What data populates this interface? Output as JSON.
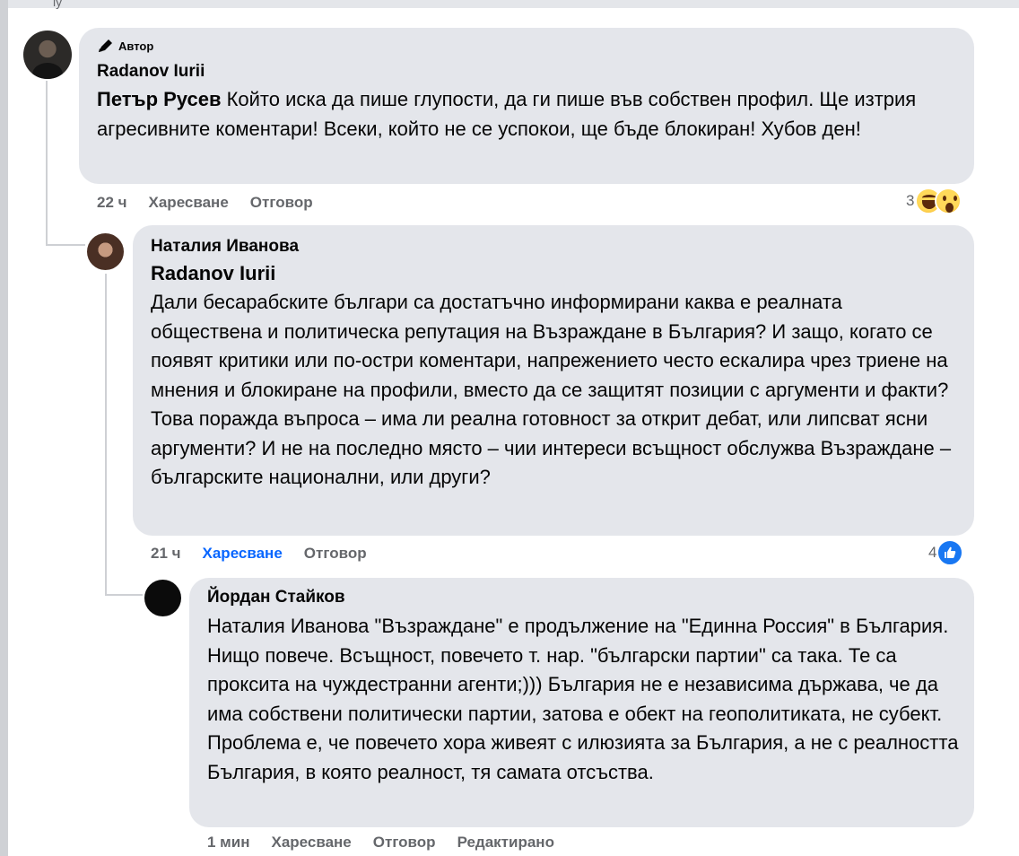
{
  "top_sliver_text": "ly",
  "comments": [
    {
      "badge": "Автор",
      "author": "Radanov Iurii",
      "mention": "Петър Русев",
      "body": " Който иска да пише глупости, да ги пише във собствен профил. Ще изтрия агресивните коментари! Всеки, който не се успокои, ще бъде блокиран! Хубов ден!",
      "time": "22 ч",
      "like_label": "Харесване",
      "reply_label": "Отговор",
      "reaction_count": "3",
      "reactions": [
        "haha-emoji-icon",
        "wow-emoji-icon"
      ]
    },
    {
      "author": "Наталия Иванова",
      "mention": "Radanov Iurii",
      "body": "Дали бесарабските българи са достатъчно информирани каква е реалната обществена и политическа репутация на Възраждане в България? И защо, когато се появят критики или по-остри коментари, напрежението често ескалира чрез триене на мнения и блокиране на профили, вместо да се защитят позиции с аргументи и факти? Това поражда въпроса – има ли реална готовност за открит дебат, или липсват ясни аргументи? И не на последно място – чии интереси всъщност обслужва Възраждане – българските национални, или други?",
      "time": "21 ч",
      "like_label": "Харесване",
      "reply_label": "Отговор",
      "reaction_count": "4",
      "reactions": [
        "like-icon"
      ],
      "liked": true
    },
    {
      "author": "Йордан Стайков",
      "body": "Наталия Иванова \"Възраждане\" е продължение на \"Единна Россия\" в България. Нищо повече. Всъщност, повечето т. нар. \"български партии\" са така. Те са проксита на чуждестранни агенти;))) България не е независима държава, че да има собствени политически партии, затова е обект на геополитиката, не субект. Проблема е, че повечето хора живеят с илюзията за България, а не с реалността България, в която реалност, тя самата отсъства.",
      "time": "1 мин",
      "like_label": "Харесване",
      "reply_label": "Отговор",
      "edited_label": "Редактирано"
    }
  ],
  "colors": {
    "bubble": "#e4e6eb",
    "meta_text": "#65676b",
    "liked_blue": "#0866ff",
    "like_badge": "#1877f2"
  }
}
